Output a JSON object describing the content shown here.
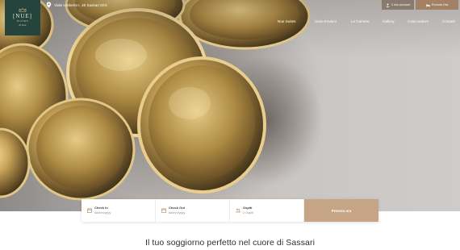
{
  "brand": {
    "logo_name": "[NUE]",
    "logo_sub": "SUITES",
    "logo_script": "di Sara",
    "colors": {
      "logo_bg": "#25443b",
      "accent": "#a28164",
      "submit_bg": "#c5a586"
    }
  },
  "header": {
    "address": "Viale Umberto I, 46 Sassari 0XX",
    "account_label": "Il mio account",
    "book_label": "Prenota Ora"
  },
  "nav": {
    "items": [
      {
        "label": "Nue Suites"
      },
      {
        "label": "Dove trovarci"
      },
      {
        "label": "Le Camere"
      },
      {
        "label": "Gallery"
      },
      {
        "label": "Cosa vedere"
      },
      {
        "label": "Contatti"
      }
    ]
  },
  "booking": {
    "checkin": {
      "label": "Check In",
      "value": "dd/mm/yyyy"
    },
    "checkout": {
      "label": "Check Out",
      "value": "dd/mm/yyyy"
    },
    "guests": {
      "label": "Ospiti",
      "value": "2 Ospiti"
    },
    "submit_label": "Prenota ora"
  },
  "main": {
    "headline": "Il tuo soggiorno perfetto nel cuore di Sassari"
  },
  "icons": {
    "address": "map-pin-icon",
    "account": "user-icon",
    "book": "bed-icon",
    "checkin": "calendar-icon",
    "checkout": "calendar-icon",
    "guests": "users-icon"
  }
}
